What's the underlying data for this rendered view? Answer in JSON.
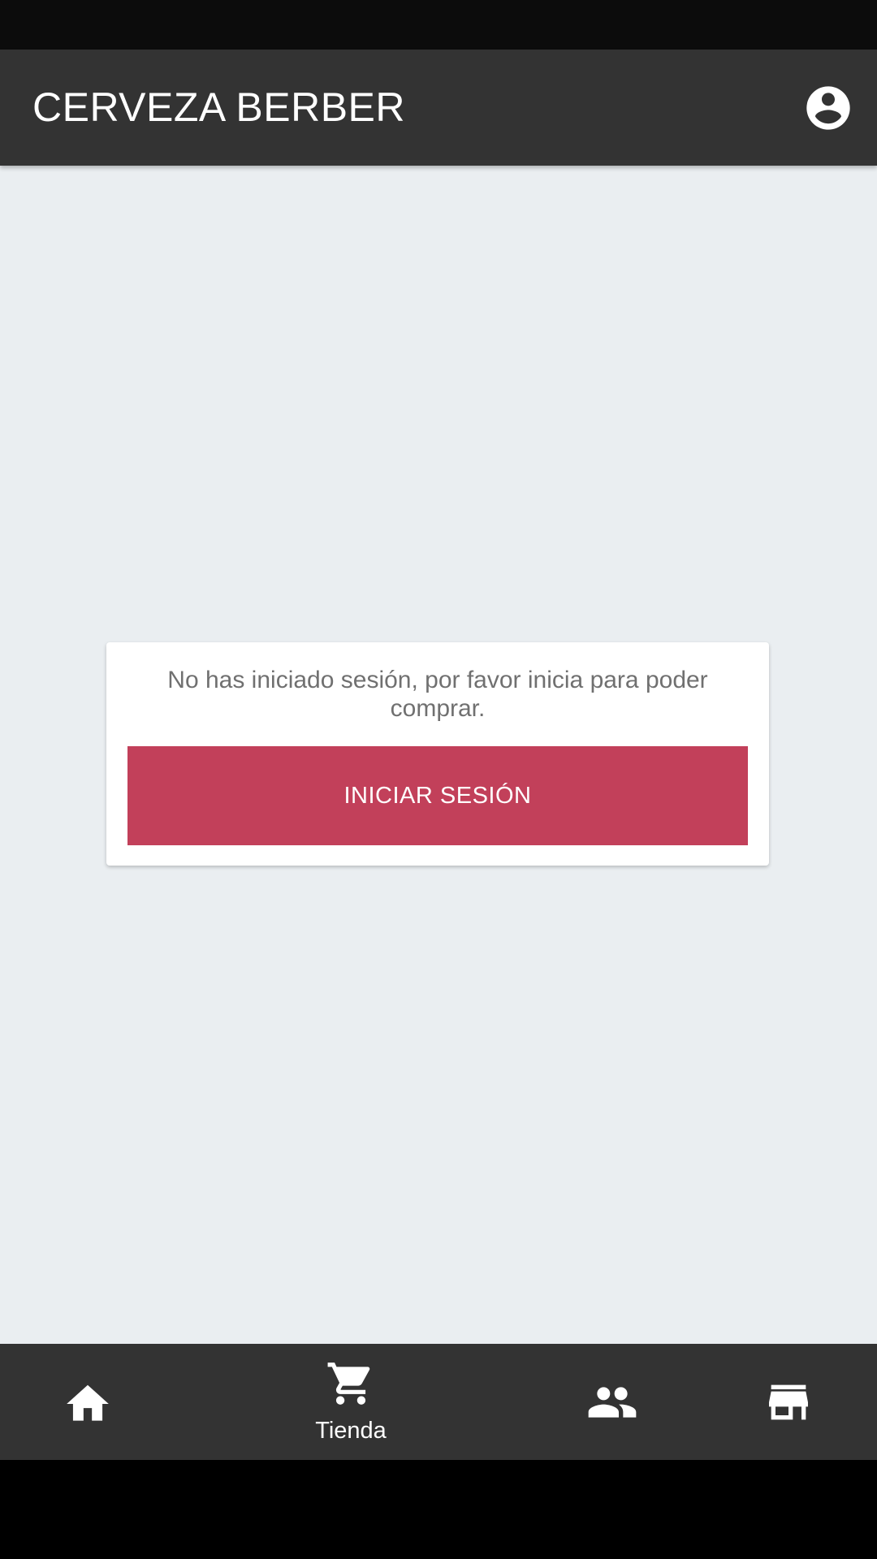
{
  "app_bar": {
    "title": "CERVEZA BERBER",
    "account_icon": "account-circle-icon"
  },
  "login_prompt": {
    "message": "No has iniciado sesión, por favor inicia para poder comprar.",
    "button_label": "INICIAR SESIÓN"
  },
  "bottom_nav": {
    "items": [
      {
        "icon": "home-icon",
        "label": ""
      },
      {
        "icon": "cart-icon",
        "label": "Tienda",
        "selected": true
      },
      {
        "icon": "people-icon",
        "label": ""
      },
      {
        "icon": "store-icon",
        "label": ""
      }
    ]
  },
  "colors": {
    "app_bar": "#333333",
    "background": "#eaeef1",
    "accent": "#c2405a",
    "message_text": "#707070"
  }
}
